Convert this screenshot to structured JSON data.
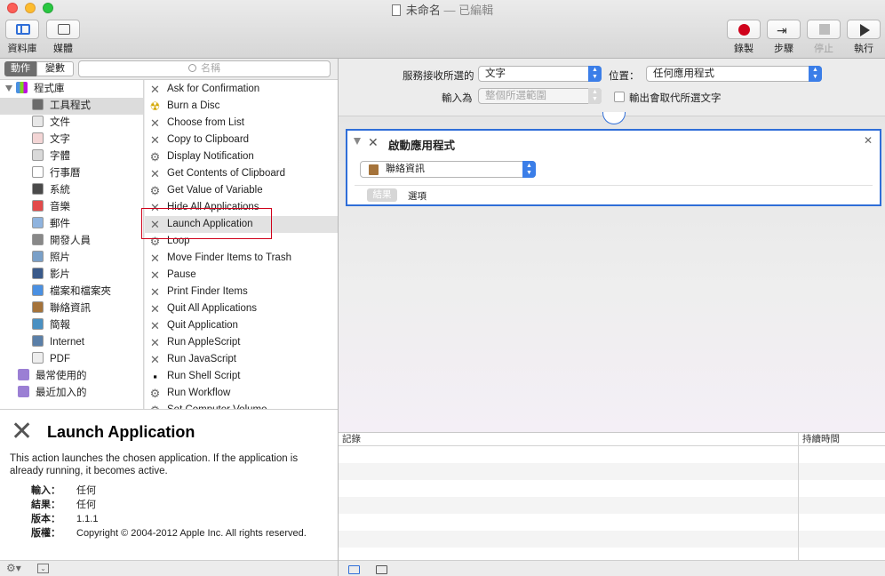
{
  "window": {
    "title": "未命名",
    "separator": "—",
    "status": "已編輯"
  },
  "toolbar": {
    "library": "資料庫",
    "media": "媒體",
    "record": "錄製",
    "step": "步驟",
    "stop": "停止",
    "run": "執行",
    "colors": {
      "record": "#d0021b",
      "accent": "#2f6ed8"
    }
  },
  "left_header": {
    "tab_actions": "動作",
    "tab_variables": "變數",
    "search_placeholder": "名稱"
  },
  "categories": {
    "root": "程式庫",
    "items": [
      {
        "label": "工具程式",
        "icon": "utilities-icon",
        "selected": true
      },
      {
        "label": "文件",
        "icon": "files-icon"
      },
      {
        "label": "文字",
        "icon": "text-icon"
      },
      {
        "label": "字體",
        "icon": "fonts-icon"
      },
      {
        "label": "行事曆",
        "icon": "calendar-icon"
      },
      {
        "label": "系統",
        "icon": "system-icon"
      },
      {
        "label": "音樂",
        "icon": "music-icon"
      },
      {
        "label": "郵件",
        "icon": "mail-icon"
      },
      {
        "label": "開發人員",
        "icon": "developer-icon"
      },
      {
        "label": "照片",
        "icon": "photos-icon"
      },
      {
        "label": "影片",
        "icon": "movies-icon"
      },
      {
        "label": "檔案和檔案夾",
        "icon": "files-folders-icon"
      },
      {
        "label": "聯絡資訊",
        "icon": "contacts-icon"
      },
      {
        "label": "簡報",
        "icon": "presentations-icon"
      },
      {
        "label": "Internet",
        "icon": "internet-icon"
      },
      {
        "label": "PDF",
        "icon": "pdf-icon"
      }
    ],
    "smart": [
      {
        "label": "最常使用的"
      },
      {
        "label": "最近加入的"
      }
    ]
  },
  "actions": [
    {
      "label": "Ask for Confirmation",
      "icon": "tools-icon"
    },
    {
      "label": "Burn a Disc",
      "icon": "burn-icon"
    },
    {
      "label": "Choose from List",
      "icon": "tools-icon"
    },
    {
      "label": "Copy to Clipboard",
      "icon": "tools-icon"
    },
    {
      "label": "Display Notification",
      "icon": "robot-icon"
    },
    {
      "label": "Get Contents of Clipboard",
      "icon": "tools-icon"
    },
    {
      "label": "Get Value of Variable",
      "icon": "robot-icon"
    },
    {
      "label": "Hide All Applications",
      "icon": "tools-icon"
    },
    {
      "label": "Launch Application",
      "icon": "tools-icon",
      "selected": true
    },
    {
      "label": "Loop",
      "icon": "robot-icon"
    },
    {
      "label": "Move Finder Items to Trash",
      "icon": "tools-icon"
    },
    {
      "label": "Pause",
      "icon": "tools-icon"
    },
    {
      "label": "Print Finder Items",
      "icon": "tools-icon"
    },
    {
      "label": "Quit All Applications",
      "icon": "tools-icon"
    },
    {
      "label": "Quit Application",
      "icon": "tools-icon"
    },
    {
      "label": "Run AppleScript",
      "icon": "tools-icon"
    },
    {
      "label": "Run JavaScript",
      "icon": "tools-icon"
    },
    {
      "label": "Run Shell Script",
      "icon": "terminal-icon"
    },
    {
      "label": "Run Workflow",
      "icon": "robot-icon"
    },
    {
      "label": "Set Computer Volume",
      "icon": "robot-icon"
    }
  ],
  "description": {
    "title": "Launch Application",
    "text": "This action launches the chosen application. If the application is already running, it becomes active.",
    "meta": [
      {
        "key": "輸入：",
        "value": "任何"
      },
      {
        "key": "結果：",
        "value": "任何"
      },
      {
        "key": "版本：",
        "value": "1.1.1"
      },
      {
        "key": "版權：",
        "value": "Copyright © 2004-2012 Apple Inc.  All rights reserved."
      }
    ]
  },
  "workflow_header": {
    "receives_label": "服務接收所選的",
    "receives_value": "文字",
    "in_label": "位置：",
    "in_value": "任何應用程式",
    "input_is_label": "輸入為",
    "input_is_value": "整個所選範圍",
    "replace_label": "輸出會取代所選文字"
  },
  "action_card": {
    "title": "啟動應用程式",
    "app_value": "聯絡資訊",
    "results_tab": "結果",
    "options_tab": "選項"
  },
  "log": {
    "col_log": "記錄",
    "col_duration": "持續時間"
  }
}
